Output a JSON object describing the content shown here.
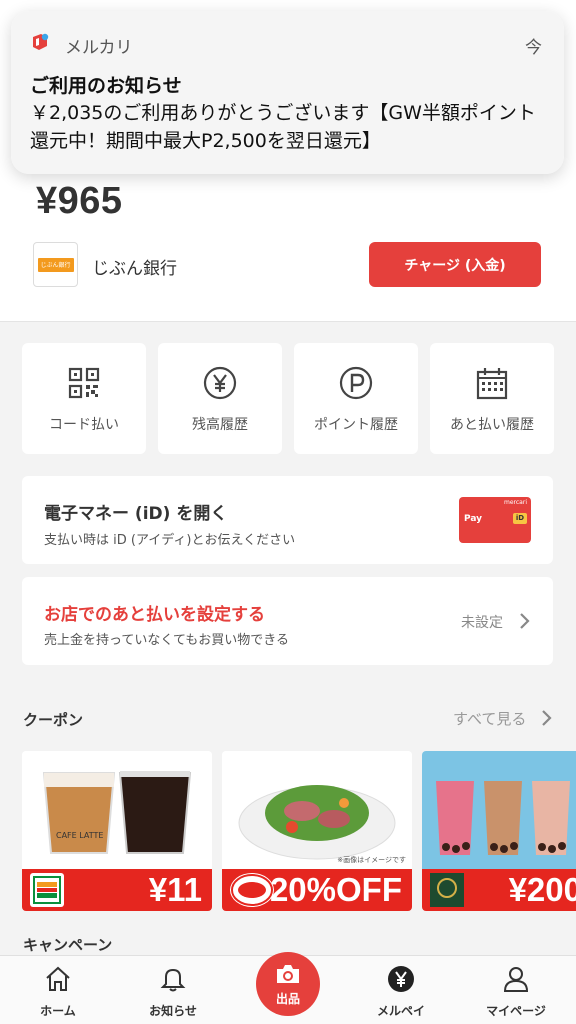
{
  "notification": {
    "app_name": "メルカリ",
    "time": "今",
    "title": "ご利用のお知らせ",
    "body": "￥2,035のご利用ありがとうございます【GW半額ポイント還元中！期間中最大P2,500を翌日還元】"
  },
  "wallet": {
    "balance": "¥965",
    "bank_name": "じぶん銀行",
    "bank_logo_text": "じぶん銀行",
    "charge_button": "チャージ (入金)"
  },
  "quick_menu": [
    {
      "label": "コード払い",
      "icon": "qr-code-icon"
    },
    {
      "label": "残高履歴",
      "icon": "yen-circle-icon"
    },
    {
      "label": "ポイント履歴",
      "icon": "point-circle-icon"
    },
    {
      "label": "あと払い履歴",
      "icon": "calendar-icon"
    }
  ],
  "id_card": {
    "title": "電子マネー (iD) を開く",
    "subtitle": "支払い時は iD (アイディ)とお伝えください",
    "card_pay_text": "Pay",
    "card_brand_text": "mercari",
    "card_id_text": "iD"
  },
  "deferred": {
    "title": "お店でのあと払いを設定する",
    "subtitle": "売上金を持っていなくてもお買い物できる",
    "status": "未設定"
  },
  "coupons": {
    "title": "クーポン",
    "see_all": "すべて見る",
    "items": [
      {
        "amount": "¥11",
        "store": "seven-eleven",
        "product_text": "CAFE LATTE"
      },
      {
        "amount": "20%OFF",
        "store": "jonathan",
        "note": "※画像はイメージです"
      },
      {
        "amount": "¥200",
        "store": "pronto"
      }
    ]
  },
  "campaign": {
    "title": "キャンペーン"
  },
  "tabbar": {
    "home": "ホーム",
    "notifications": "お知らせ",
    "sell": "出品",
    "merpay": "メルペイ",
    "mypage": "マイページ"
  },
  "colors": {
    "accent": "#e5403c",
    "coupon_banner": "#e5261f"
  }
}
